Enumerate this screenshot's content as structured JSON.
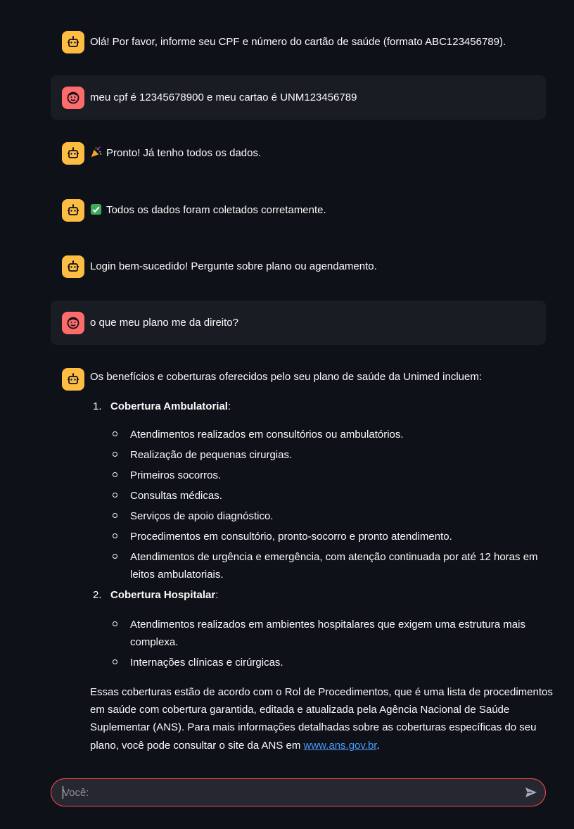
{
  "messages": [
    {
      "role": "assistant",
      "avatar_icon": "robot-icon",
      "text": "Olá! Por favor, informe seu CPF e número do cartão de saúde (formato ABC123456789)."
    },
    {
      "role": "user",
      "avatar_icon": "smiley-icon",
      "text": "meu cpf é 12345678900 e meu cartao é UNM123456789"
    },
    {
      "role": "assistant",
      "avatar_icon": "robot-icon",
      "emoji": "party-popper",
      "text": "Pronto! Já tenho todos os dados."
    },
    {
      "role": "assistant",
      "avatar_icon": "robot-icon",
      "emoji": "check-mark",
      "text": "Todos os dados foram coletados corretamente."
    },
    {
      "role": "assistant",
      "avatar_icon": "robot-icon",
      "text": "Login bem-sucedido! Pergunte sobre plano ou agendamento."
    },
    {
      "role": "user",
      "avatar_icon": "smiley-icon",
      "text": "o que meu plano me da direito?"
    }
  ],
  "answer": {
    "intro": "Os benefícios e coberturas oferecidos pelo seu plano de saúde da Unimed incluem:",
    "sections": [
      {
        "number": "1.",
        "title": "Cobertura Ambulatorial",
        "suffix": ":",
        "items": [
          [
            "Atendimentos realizados em consultórios ou ambulatórios."
          ],
          [
            "Realização de pequenas cirurgias."
          ],
          [
            "Primeiros socorros."
          ],
          [
            "Consultas médicas."
          ],
          [
            "Serviços de apoio diagnóstico."
          ],
          [
            "Procedimentos em consultório, pronto-socorro e pronto atendimento."
          ],
          [
            "Atendimentos de urgência e emergência, com atenção continuada por até 12 horas em",
            "leitos ambulatoriais."
          ]
        ]
      },
      {
        "number": "2.",
        "title": "Cobertura Hospitalar",
        "suffix": ":",
        "items": [
          [
            "Atendimentos realizados em ambientes hospitalares que exigem uma estrutura mais",
            "complexa."
          ],
          [
            "Internações clínicas e cirúrgicas."
          ]
        ]
      }
    ],
    "closing_lines": [
      "Essas coberturas estão de acordo com o Rol de Procedimentos, que é uma lista de procedimentos",
      "em saúde com cobertura garantida, editada e atualizada pela Agência Nacional de Saúde",
      "Suplementar (ANS). Para mais informações detalhadas sobre as coberturas específicas do seu"
    ],
    "closing_last_prefix": "plano, você pode consultar o site da ANS em ",
    "closing_link": "www.ans.gov.br",
    "closing_last_suffix": "."
  },
  "chat_input": {
    "placeholder": "Você:",
    "value": "",
    "send_icon": "send-icon"
  },
  "colors": {
    "background": "#0e1117",
    "user_bubble": "#1a1c24",
    "bot_avatar": "#fdbd42",
    "user_avatar": "#ff6b6b",
    "input_border": "#ff4b4b",
    "link": "#4b9bff"
  }
}
